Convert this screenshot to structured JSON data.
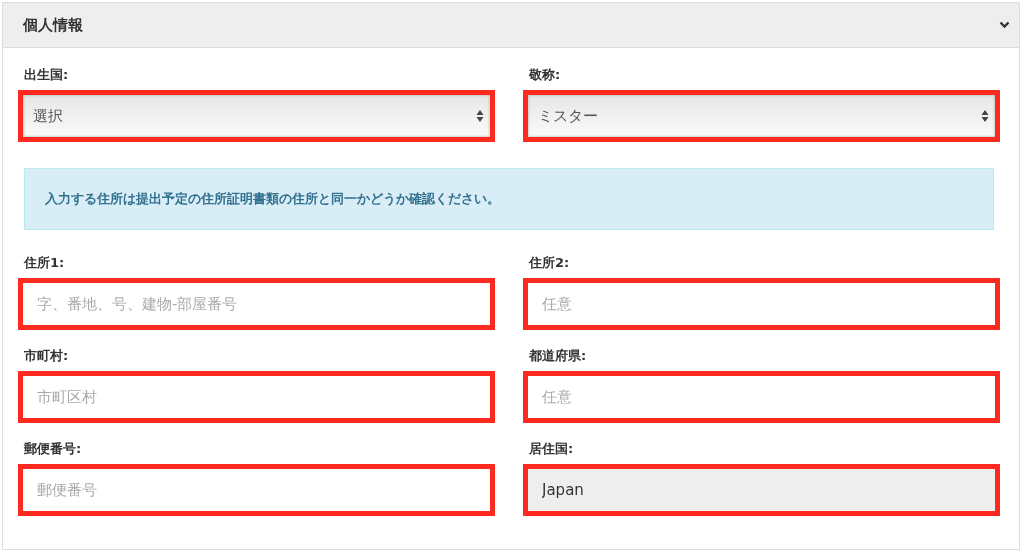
{
  "panel": {
    "title": "個人情報",
    "expanded": true
  },
  "rows": [
    {
      "fields": [
        {
          "label": "出生国:",
          "kind": "select",
          "value": "選択",
          "highlighted": true
        },
        {
          "label": "敬称:",
          "kind": "select",
          "value": "ミスター",
          "highlighted": true
        }
      ]
    },
    {
      "notice": "入力する住所は提出予定の住所証明書類の住所と同一かどうか確認ください。"
    },
    {
      "fields": [
        {
          "label": "住所1:",
          "kind": "text",
          "placeholder": "字、番地、号、建物-部屋番号",
          "highlighted": true
        },
        {
          "label": "住所2:",
          "kind": "text",
          "placeholder": "任意",
          "highlighted": true
        }
      ]
    },
    {
      "fields": [
        {
          "label": "市町村:",
          "kind": "text",
          "placeholder": "市町区村",
          "highlighted": true
        },
        {
          "label": "都道府県:",
          "kind": "text",
          "placeholder": "任意",
          "highlighted": true
        }
      ]
    },
    {
      "fields": [
        {
          "label": "郵便番号:",
          "kind": "text",
          "placeholder": "郵便番号",
          "highlighted": true
        },
        {
          "label": "居住国:",
          "kind": "text",
          "value": "Japan",
          "disabled": true,
          "highlighted": true
        }
      ]
    }
  ]
}
